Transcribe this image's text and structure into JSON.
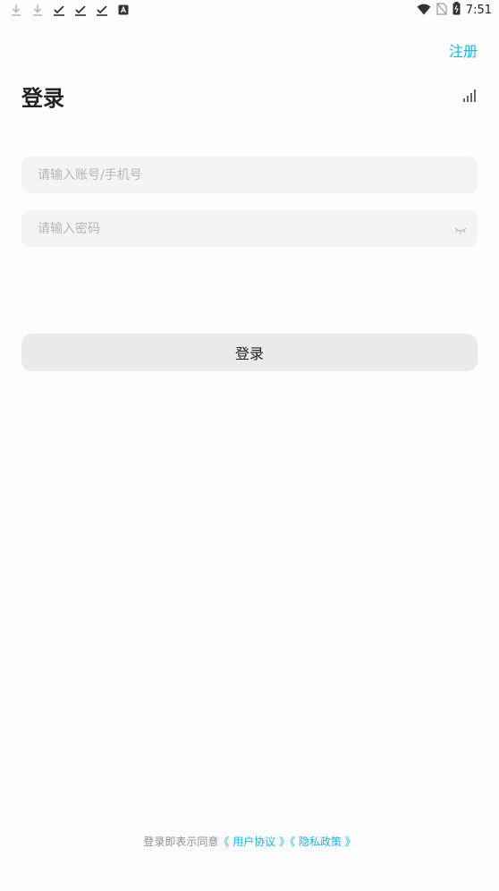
{
  "status_bar": {
    "time": "7:51",
    "left_icons": [
      "download-icon",
      "download-icon",
      "check-download-icon",
      "check-download-icon",
      "check-download-icon",
      "app-notification-icon"
    ],
    "right_icons": [
      "wifi-icon",
      "no-sim-icon",
      "battery-icon"
    ]
  },
  "header": {
    "register_label": "注册",
    "title": "登录"
  },
  "form": {
    "account_placeholder": "请输入账号/手机号",
    "password_placeholder": "请输入密码",
    "login_label": "登录"
  },
  "footer": {
    "prefix": "登录即表示同意",
    "user_agreement": "《 用户协议 》",
    "privacy_policy": "《 隐私政策 》"
  },
  "colors": {
    "accent": "#19b6e6",
    "field_bg": "#f4f4f5",
    "button_bg": "#e9eaec"
  }
}
